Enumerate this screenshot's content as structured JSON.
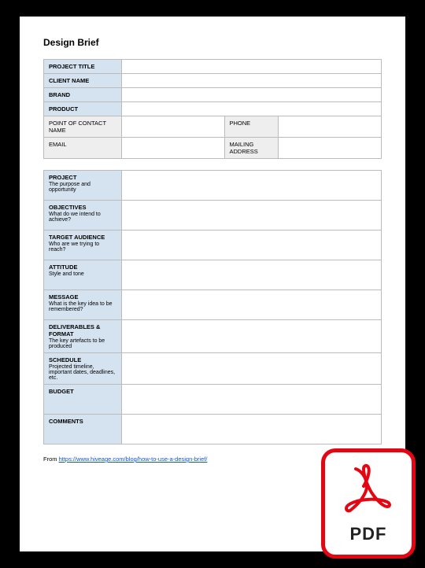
{
  "title": "Design Brief",
  "table1": {
    "project_title": {
      "label": "PROJECT TITLE",
      "value": ""
    },
    "client_name": {
      "label": "CLIENT NAME",
      "value": ""
    },
    "brand": {
      "label": "BRAND",
      "value": ""
    },
    "product": {
      "label": "PRODUCT",
      "value": ""
    },
    "poc": {
      "label": "POINT OF CONTACT NAME",
      "value": ""
    },
    "phone": {
      "label": "PHONE",
      "value": ""
    },
    "email": {
      "label": "EMAIL",
      "value": ""
    },
    "mailing": {
      "label": "MAILING ADDRESS",
      "value": ""
    }
  },
  "table2": {
    "project": {
      "label": "PROJECT",
      "sub": "The purpose and opportunity",
      "value": ""
    },
    "objectives": {
      "label": "OBJECTIVES",
      "sub": "What do we intend to achieve?",
      "value": ""
    },
    "audience": {
      "label": "TARGET AUDIENCE",
      "sub": "Who are we trying to reach?",
      "value": ""
    },
    "attitude": {
      "label": "ATTITUDE",
      "sub": "Style and tone",
      "value": ""
    },
    "message": {
      "label": "MESSAGE",
      "sub": "What is the key idea to be remembered?",
      "value": ""
    },
    "deliverables": {
      "label": "DELIVERABLES & FORMAT",
      "sub": "The key artefacts to be produced",
      "value": ""
    },
    "schedule": {
      "label": "SCHEDULE",
      "sub": "Projected timeline, important dates, deadlines, etc.",
      "value": ""
    },
    "budget": {
      "label": "BUDGET",
      "sub": "",
      "value": ""
    },
    "comments": {
      "label": "COMMENTS",
      "sub": "",
      "value": ""
    }
  },
  "footer": {
    "prefix": "From ",
    "link_text": "https://www.hiveage.com/blog/how-to-use-a-design-brief/"
  },
  "badge": {
    "label": "PDF"
  }
}
